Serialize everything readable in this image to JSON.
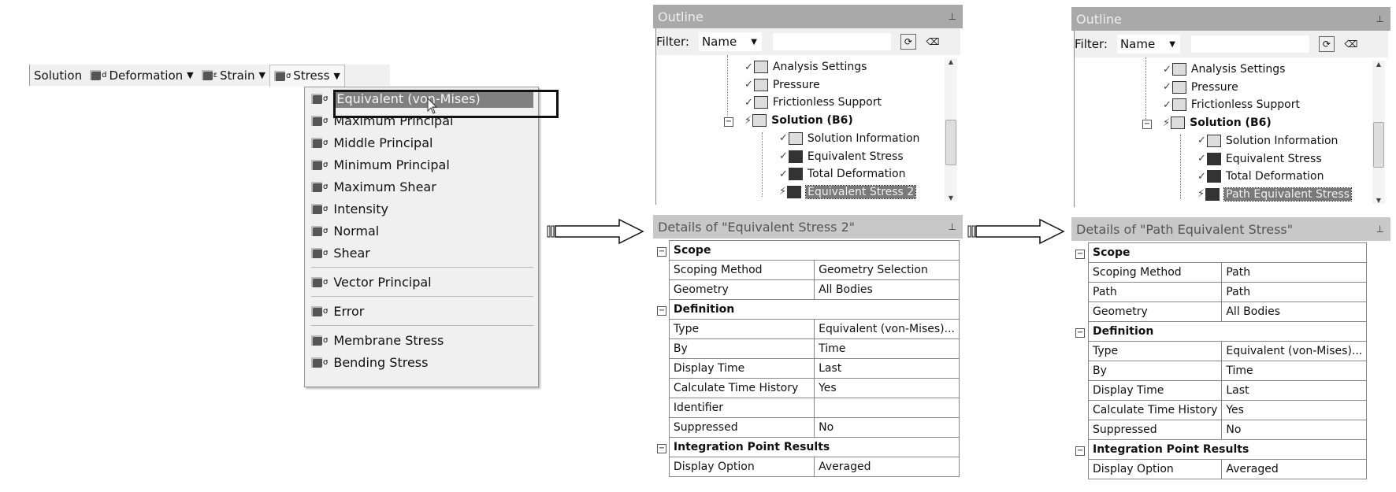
{
  "toolbar": {
    "solution_label": "Solution",
    "buttons": [
      {
        "label": "Deformation",
        "icon": "deformation-result-icon",
        "sub": "d"
      },
      {
        "label": "Strain",
        "icon": "strain-result-icon",
        "sub": "ε"
      },
      {
        "label": "Stress",
        "icon": "stress-result-icon",
        "sub": "σ"
      }
    ]
  },
  "stress_menu": {
    "groups": [
      [
        "Equivalent (von-Mises)",
        "Maximum Principal",
        "Middle Principal",
        "Minimum Principal",
        "Maximum Shear",
        "Intensity",
        "Normal",
        "Shear"
      ],
      [
        "Vector Principal"
      ],
      [
        "Error"
      ],
      [
        "Membrane Stress",
        "Bending Stress"
      ]
    ],
    "selected": "Equivalent (von-Mises)"
  },
  "panels": [
    {
      "outline_title": "Outline",
      "filter_label": "Filter:",
      "filter_value": "Name",
      "tree": [
        {
          "label": "Analysis Settings",
          "level": 1,
          "kind": "settings"
        },
        {
          "label": "Pressure",
          "level": 1,
          "kind": "load"
        },
        {
          "label": "Frictionless Support",
          "level": 1,
          "kind": "support"
        },
        {
          "label": "Solution (B6)",
          "level": 1,
          "kind": "solution",
          "bold": true
        },
        {
          "label": "Solution Information",
          "level": 2,
          "kind": "info"
        },
        {
          "label": "Equivalent Stress",
          "level": 2,
          "kind": "result"
        },
        {
          "label": "Total Deformation",
          "level": 2,
          "kind": "result"
        },
        {
          "label": "Equivalent Stress 2",
          "level": 2,
          "kind": "result",
          "selected": true
        }
      ],
      "details_title": "Details of \"Equivalent Stress 2\"",
      "details": [
        {
          "group": "Scope",
          "rows": [
            [
              "Scoping Method",
              "Geometry Selection"
            ],
            [
              "Geometry",
              "All Bodies"
            ]
          ]
        },
        {
          "group": "Definition",
          "rows": [
            [
              "Type",
              "Equivalent (von-Mises)..."
            ],
            [
              "By",
              "Time"
            ],
            [
              "Display Time",
              "Last"
            ],
            [
              "Calculate Time History",
              "Yes"
            ],
            [
              "Identifier",
              ""
            ],
            [
              "Suppressed",
              "No"
            ]
          ]
        },
        {
          "group": "Integration Point Results",
          "rows": [
            [
              "Display Option",
              "Averaged"
            ]
          ]
        }
      ]
    },
    {
      "outline_title": "Outline",
      "filter_label": "Filter:",
      "filter_value": "Name",
      "tree": [
        {
          "label": "Analysis Settings",
          "level": 1,
          "kind": "settings"
        },
        {
          "label": "Pressure",
          "level": 1,
          "kind": "load"
        },
        {
          "label": "Frictionless Support",
          "level": 1,
          "kind": "support"
        },
        {
          "label": "Solution (B6)",
          "level": 1,
          "kind": "solution",
          "bold": true
        },
        {
          "label": "Solution Information",
          "level": 2,
          "kind": "info"
        },
        {
          "label": "Equivalent Stress",
          "level": 2,
          "kind": "result"
        },
        {
          "label": "Total Deformation",
          "level": 2,
          "kind": "result"
        },
        {
          "label": "Path Equivalent Stress",
          "level": 2,
          "kind": "result",
          "selected": true
        }
      ],
      "details_title": "Details of \"Path Equivalent Stress\"",
      "details": [
        {
          "group": "Scope",
          "rows": [
            [
              "Scoping Method",
              "Path"
            ],
            [
              "Path",
              "Path"
            ],
            [
              "Geometry",
              "All Bodies"
            ]
          ]
        },
        {
          "group": "Definition",
          "rows": [
            [
              "Type",
              "Equivalent (von-Mises)..."
            ],
            [
              "By",
              "Time"
            ],
            [
              "Display Time",
              "Last"
            ],
            [
              "Calculate Time History",
              "Yes"
            ],
            [
              "Suppressed",
              "No"
            ]
          ]
        },
        {
          "group": "Integration Point Results",
          "rows": [
            [
              "Display Option",
              "Averaged"
            ]
          ]
        }
      ]
    }
  ],
  "colors": {
    "selection": "#7a7a7a",
    "outline_header": "#a9a9a9",
    "details_header": "#c8c8c8"
  }
}
